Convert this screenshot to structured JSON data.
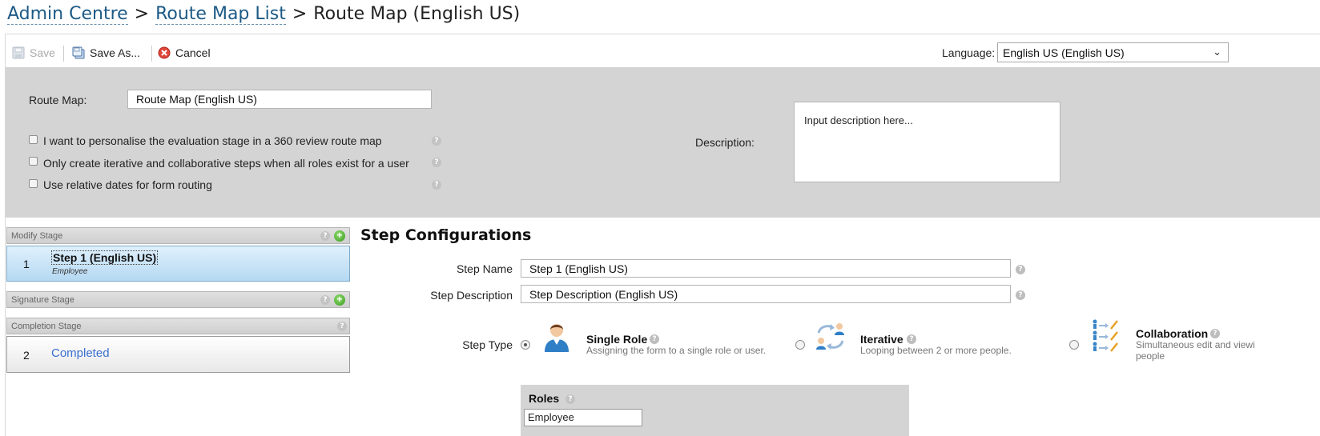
{
  "breadcrumb": {
    "admin": "Admin Centre",
    "list": "Route Map List",
    "sep": ">",
    "current": "Route Map (English US)"
  },
  "toolbar": {
    "save": "Save",
    "save_as": "Save As...",
    "cancel": "Cancel",
    "language_label": "Language:",
    "language_value": "English US (English US)"
  },
  "form": {
    "route_map_label": "Route Map:",
    "route_map_value": "Route Map (English US)",
    "options": [
      {
        "label": "I want to personalise the evaluation stage in a 360 review route map",
        "checked": false
      },
      {
        "label": "Only create iterative and collaborative steps when all roles exist for a user",
        "checked": false
      },
      {
        "label": "Use relative dates for form routing",
        "checked": false
      }
    ],
    "description_label": "Description:",
    "description_placeholder": "Input description here..."
  },
  "stages": {
    "modify": "Modify Stage",
    "signature": "Signature Stage",
    "completion": "Completion Stage",
    "steps": [
      {
        "num": "1",
        "name": "Step 1 (English US)",
        "role": "Employee"
      },
      {
        "num": "2",
        "name": "Completed"
      }
    ]
  },
  "step_config": {
    "title": "Step Configurations",
    "step_name_label": "Step Name",
    "step_name_value": "Step 1 (English US)",
    "step_desc_label": "Step Description",
    "step_desc_value": "Step Description (English US)",
    "step_type_label": "Step Type",
    "types": [
      {
        "title": "Single Role",
        "desc": "Assigning the form to a single role or user.",
        "selected": true
      },
      {
        "title": "Iterative",
        "desc": "Looping between 2 or more people.",
        "selected": false
      },
      {
        "title": "Collaboration",
        "desc": "Simultaneous edit and viewi",
        "desc2": "people",
        "selected": false
      }
    ],
    "roles_title": "Roles",
    "roles_value": "Employee"
  },
  "help_glyph": "?",
  "plus_glyph": "+",
  "colors": {
    "link": "#1c5a86",
    "panel": "#d4d4d4",
    "active_step": "#b5d9f2",
    "completed_link": "#3b6fd0"
  }
}
